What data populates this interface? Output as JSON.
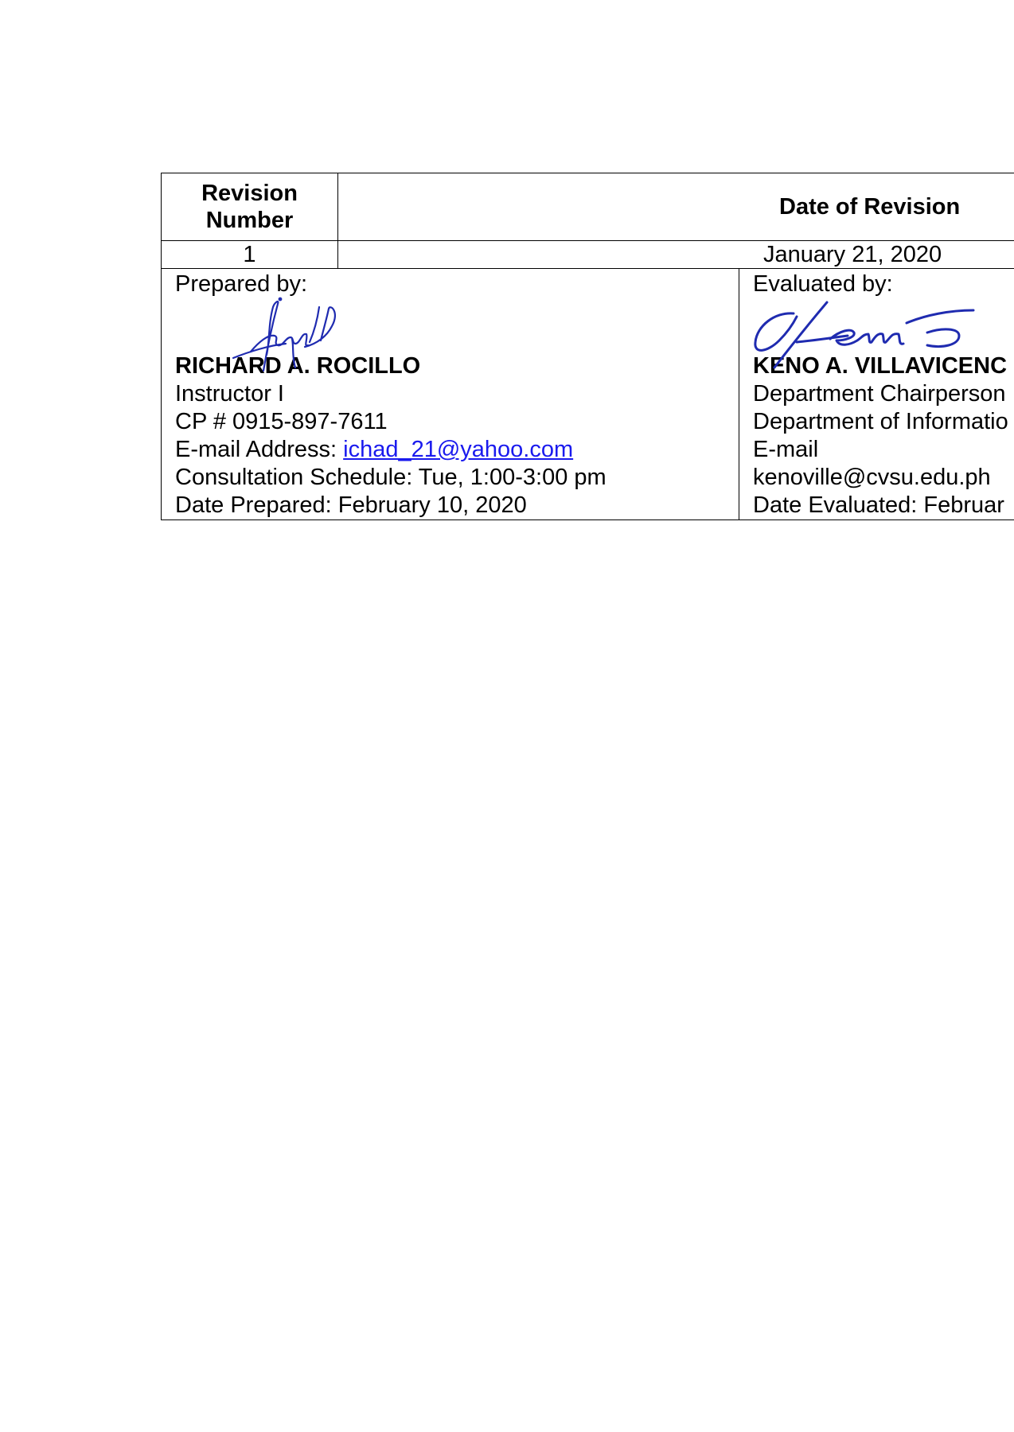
{
  "revision_table": {
    "header_revision_number": "Revision Number",
    "header_revision_number_line1": "Revision",
    "header_revision_number_line2": "Number",
    "header_date_of_revision": "Date of Revision",
    "revision_number": "1",
    "date_of_revision": "January 21, 2020"
  },
  "prepared": {
    "label": "Prepared by:",
    "name": "RICHARD A. ROCILLO",
    "title": "Instructor I",
    "contact": "CP # 0915-897-7611",
    "email_label": "E-mail Address: ",
    "email": "ichad_21@yahoo.com",
    "schedule": "Consultation Schedule: Tue, 1:00-3:00 pm",
    "date": "Date Prepared: February 10, 2020"
  },
  "evaluated": {
    "label": "Evaluated by:",
    "name": "KENO A. VILLAVICENC",
    "title": "Department Chairperson",
    "department": "Department of Informatio",
    "email_label": "E-mail",
    "email": "kenoville@cvsu.edu.ph",
    "date": "Date Evaluated: Februar"
  },
  "colors": {
    "signature_ink": "#1f2bb0",
    "link": "#1a1aee"
  },
  "icons": {
    "prepared_signature": "handwritten-signature",
    "evaluated_signature": "handwritten-signature"
  }
}
